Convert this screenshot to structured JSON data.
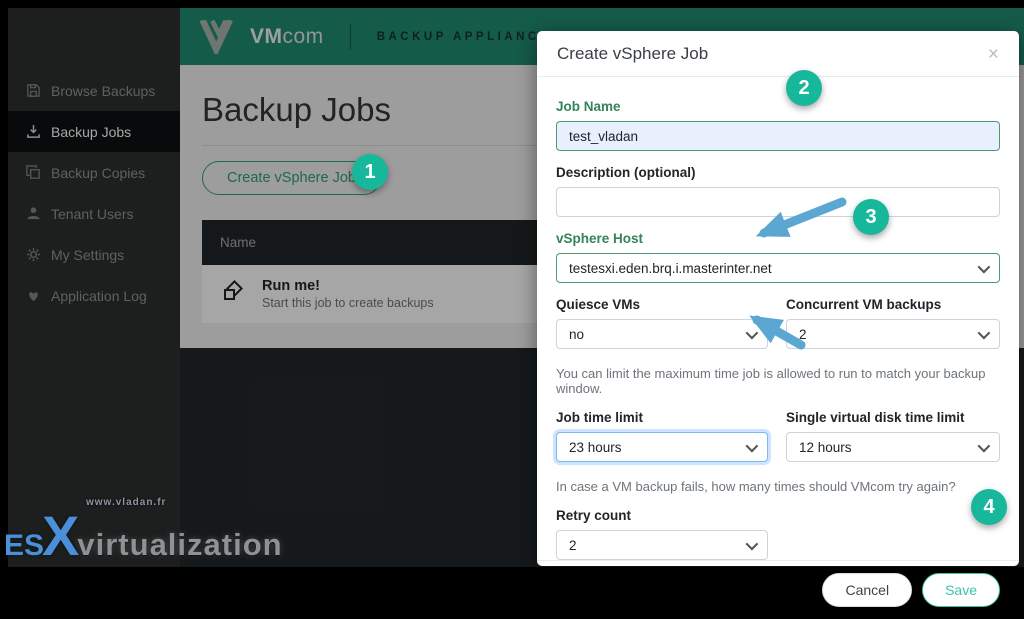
{
  "sidebar": {
    "items": [
      {
        "label": "Browse Backups",
        "icon": "floppy-icon",
        "active": false
      },
      {
        "label": "Backup Jobs",
        "icon": "download-icon",
        "active": true
      },
      {
        "label": "Backup Copies",
        "icon": "copy-icon",
        "active": false
      },
      {
        "label": "Tenant Users",
        "icon": "user-icon",
        "active": false
      },
      {
        "label": "My Settings",
        "icon": "gear-icon",
        "active": false
      },
      {
        "label": "Application Log",
        "icon": "heart-icon",
        "active": false
      }
    ]
  },
  "header": {
    "brand_bold": "VM",
    "brand_rest": "com",
    "product": "BACKUP APPLIANCE"
  },
  "page": {
    "title": "Backup Jobs",
    "create_button": "Create vSphere Job"
  },
  "jobs_table": {
    "name_header": "Name",
    "rows": [
      {
        "title": "Run me!",
        "subtitle": "Start this job to create backups",
        "icon": "vsphere-icon"
      }
    ]
  },
  "modal": {
    "title": "Create vSphere Job",
    "close": "×",
    "fields": {
      "job_name": {
        "label": "Job Name",
        "value": "test_vladan"
      },
      "description": {
        "label": "Description (optional)",
        "value": "",
        "placeholder": ""
      },
      "vsphere_host": {
        "label": "vSphere Host",
        "value": "testesxi.eden.brq.i.masterinter.net"
      },
      "quiesce": {
        "label": "Quiesce VMs",
        "value": "no"
      },
      "concurrent": {
        "label": "Concurrent VM backups",
        "value": "2"
      },
      "job_time": {
        "label": "Job time limit",
        "value": "23 hours"
      },
      "disk_time": {
        "label": "Single virtual disk time limit",
        "value": "12 hours"
      },
      "retry": {
        "label": "Retry count",
        "value": "2"
      }
    },
    "notes": {
      "time_limit": "You can limit the maximum time job is allowed to run to match your backup window.",
      "retry": "In case a VM backup fails, how many times should VMcom try again?"
    },
    "cancel_label": "Cancel",
    "save_label": "Save"
  },
  "annotations": {
    "callouts": [
      "1",
      "2",
      "3",
      "4"
    ],
    "arrow_color": "#5ba7d1"
  },
  "watermark": {
    "esx_part1": "ES",
    "esx_part2": "X",
    "rest": "virtualization",
    "url": "www.vladan.fr"
  },
  "colors": {
    "header_teal": "#218c72",
    "accent_teal": "#16b79b",
    "label_green": "#35835a",
    "active_sidebar": "#0f1011",
    "table_header": "#212529",
    "autofill_blue": "#e8f0fe",
    "arrow_blue": "#5ba7d1"
  }
}
